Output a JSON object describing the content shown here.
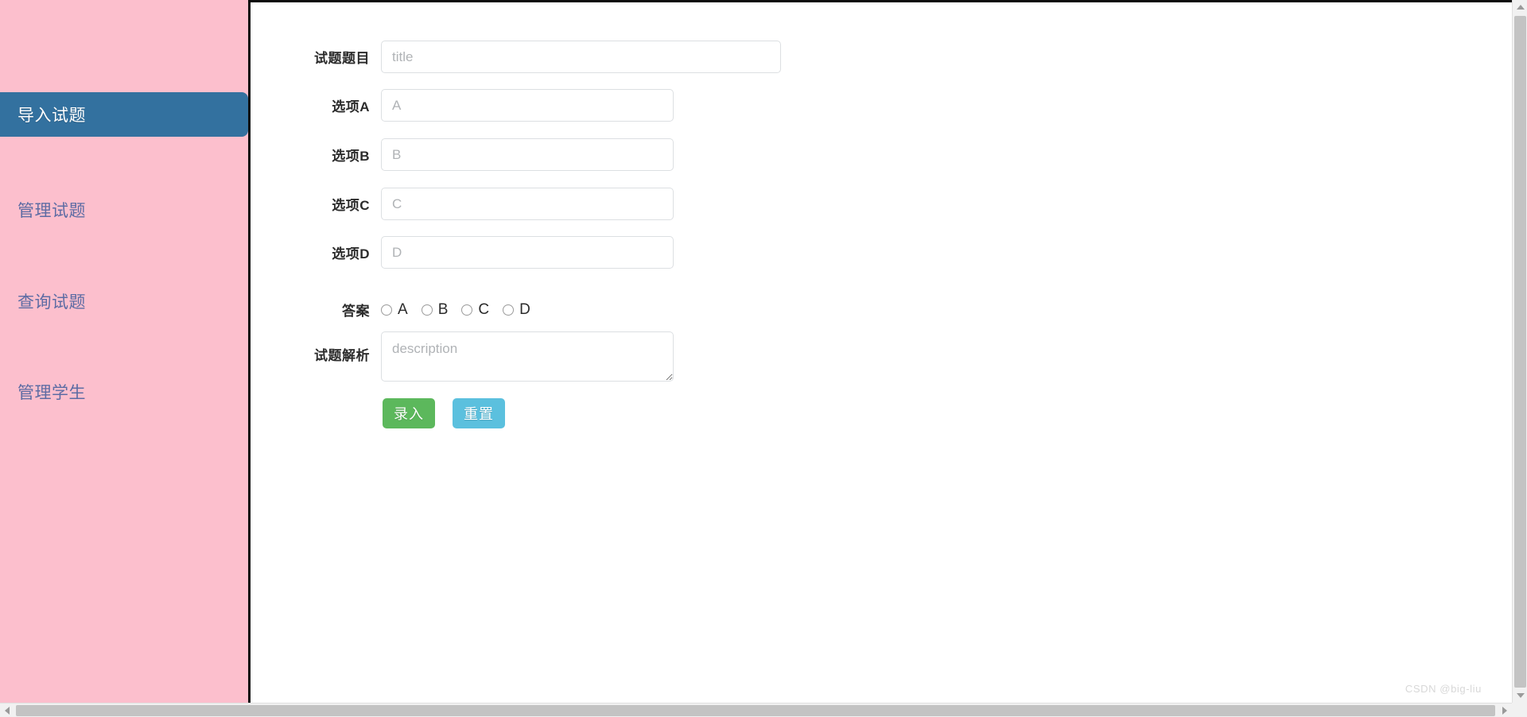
{
  "sidebar": {
    "background_color": "#fcbfcd",
    "active_color": "#33719f",
    "link_color": "#5d6ca4",
    "items": [
      {
        "label": "导入试题",
        "active": true
      },
      {
        "label": "管理试题",
        "active": false
      },
      {
        "label": "查询试题",
        "active": false
      },
      {
        "label": "管理学生",
        "active": false
      }
    ]
  },
  "form": {
    "fields": [
      {
        "label": "试题题目",
        "placeholder": "title",
        "value": ""
      },
      {
        "label": "选项A",
        "placeholder": "A",
        "value": ""
      },
      {
        "label": "选项B",
        "placeholder": "B",
        "value": ""
      },
      {
        "label": "选项C",
        "placeholder": "C",
        "value": ""
      },
      {
        "label": "选项D",
        "placeholder": "D",
        "value": ""
      }
    ],
    "answer": {
      "label": "答案",
      "options": [
        {
          "label": "A",
          "checked": false
        },
        {
          "label": "B",
          "checked": false
        },
        {
          "label": "C",
          "checked": false
        },
        {
          "label": "D",
          "checked": false
        }
      ]
    },
    "description": {
      "label": "试题解析",
      "placeholder": "description",
      "value": ""
    },
    "buttons": {
      "submit_label": "录入",
      "submit_color": "#5cb85c",
      "reset_label": "重置",
      "reset_color": "#5bc0de"
    }
  },
  "watermark": {
    "text": "CSDN @big-liu"
  }
}
